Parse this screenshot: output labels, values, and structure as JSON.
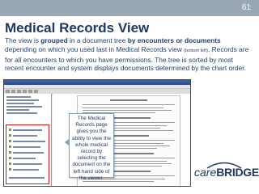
{
  "header": {
    "page_number": "61"
  },
  "slide": {
    "title": "Medical Records View",
    "desc_part1": "The view is ",
    "desc_bold1": "grouped",
    "desc_part2": " in a document tree ",
    "desc_bold2": "by encounters or documents",
    "desc_part3": " depending on which you used last in Medical Records view ",
    "desc_small": "(bottom left)",
    "desc_part4": ". Records are for all encounters to which you have permissions. The tree is sorted by most recent encounter and system displays documents determined by the chart order."
  },
  "callout": {
    "text": "The Medical Records page gives you the ability to view the whole medical record by selecting the document on the left hand side of the viewer."
  },
  "logo": {
    "part1": "care",
    "part2": "BRIDGE"
  },
  "colors": {
    "title": "#1f3864",
    "topbar": "#9aa7b4",
    "highlight_box": "#dd1111"
  }
}
